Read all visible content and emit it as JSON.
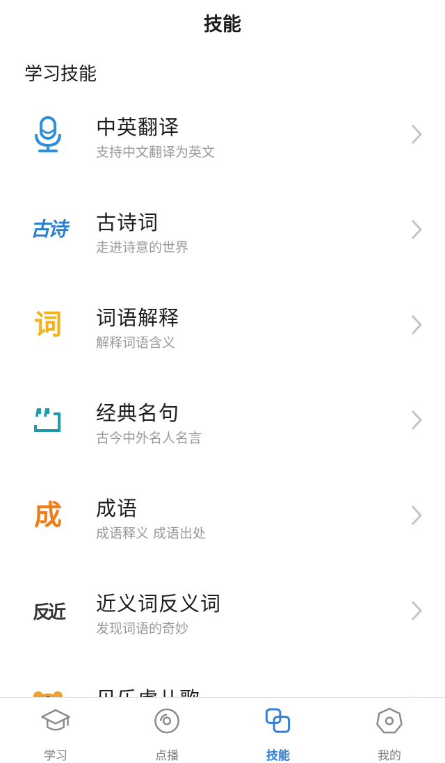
{
  "header": {
    "title": "技能"
  },
  "section": {
    "title": "学习技能"
  },
  "skills": [
    {
      "title": "中英翻译",
      "subtitle": "支持中文翻译为英文",
      "icon": "microphone-icon",
      "color": "#2f8fd8"
    },
    {
      "title": "古诗词",
      "subtitle": "走进诗意的世界",
      "icon": "ancient-poem-icon",
      "icon_text": "古诗",
      "color": "#2a7fd0"
    },
    {
      "title": "词语解释",
      "subtitle": "解释词语含义",
      "icon": "word-icon",
      "icon_text": "词",
      "color": "#f2b21b"
    },
    {
      "title": "经典名句",
      "subtitle": "古今中外名人名言",
      "icon": "quote-icon",
      "color": "#1f9aa8"
    },
    {
      "title": "成语",
      "subtitle": "成语释义 成语出处",
      "icon": "idiom-icon",
      "icon_text": "成",
      "color": "#ef7d1a"
    },
    {
      "title": "近义词反义词",
      "subtitle": "发现词语的奇妙",
      "icon": "synonym-antonym-icon",
      "icon_text": "反近",
      "color": "#333333"
    },
    {
      "title": "贝乐虎儿歌",
      "subtitle": "",
      "icon": "tiger-icon",
      "color": "#f0a030"
    }
  ],
  "tabs": [
    {
      "label": "学习",
      "icon": "graduation-cap-icon",
      "active": false
    },
    {
      "label": "点播",
      "icon": "disc-icon",
      "active": false
    },
    {
      "label": "技能",
      "icon": "skills-icon",
      "active": true
    },
    {
      "label": "我的",
      "icon": "profile-icon",
      "active": false
    }
  ],
  "colors": {
    "accent": "#2f7fd8",
    "inactive": "#7d7d7d",
    "subtitle": "#9a9a9a"
  }
}
